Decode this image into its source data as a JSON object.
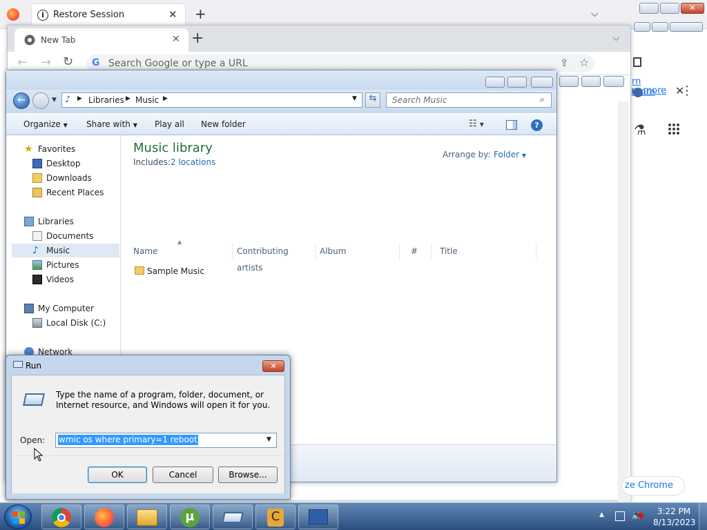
{
  "firefox": {
    "tab_title": "Restore Session"
  },
  "chrome": {
    "tab_title": "New Tab",
    "omnibox_placeholder": "Search Google or type a URL",
    "right_link": "rn more",
    "customize_button": "ze Chrome"
  },
  "explorer": {
    "breadcrumb": [
      "Libraries",
      "Music"
    ],
    "search_placeholder": "Search Music",
    "toolbar": {
      "organize": "Organize",
      "share_with": "Share with",
      "play_all": "Play all",
      "new_folder": "New folder"
    },
    "nav": {
      "favorites": "Favorites",
      "favorites_items": [
        "Desktop",
        "Downloads",
        "Recent Places"
      ],
      "libraries": "Libraries",
      "libraries_items": [
        "Documents",
        "Music",
        "Pictures",
        "Videos"
      ],
      "my_computer": "My Computer",
      "computer_items": [
        "Local Disk (C:)"
      ],
      "network": "Network"
    },
    "library_title": "Music library",
    "includes_label": "Includes:",
    "includes_link": "2 locations",
    "arrange_label": "Arrange by:",
    "arrange_value": "Folder",
    "columns": [
      "Name",
      "Contributing artists",
      "Album",
      "#",
      "Title"
    ],
    "items": [
      "Sample Music"
    ]
  },
  "run": {
    "title": "Run",
    "description": "Type the name of a program, folder, document, or Internet resource, and Windows will open it for you.",
    "open_label": "Open:",
    "open_value": "wmic os where primary=1 reboot",
    "ok": "OK",
    "cancel": "Cancel",
    "browse": "Browse..."
  },
  "taskbar": {
    "time": "3:22 PM",
    "date": "8/13/2023"
  }
}
